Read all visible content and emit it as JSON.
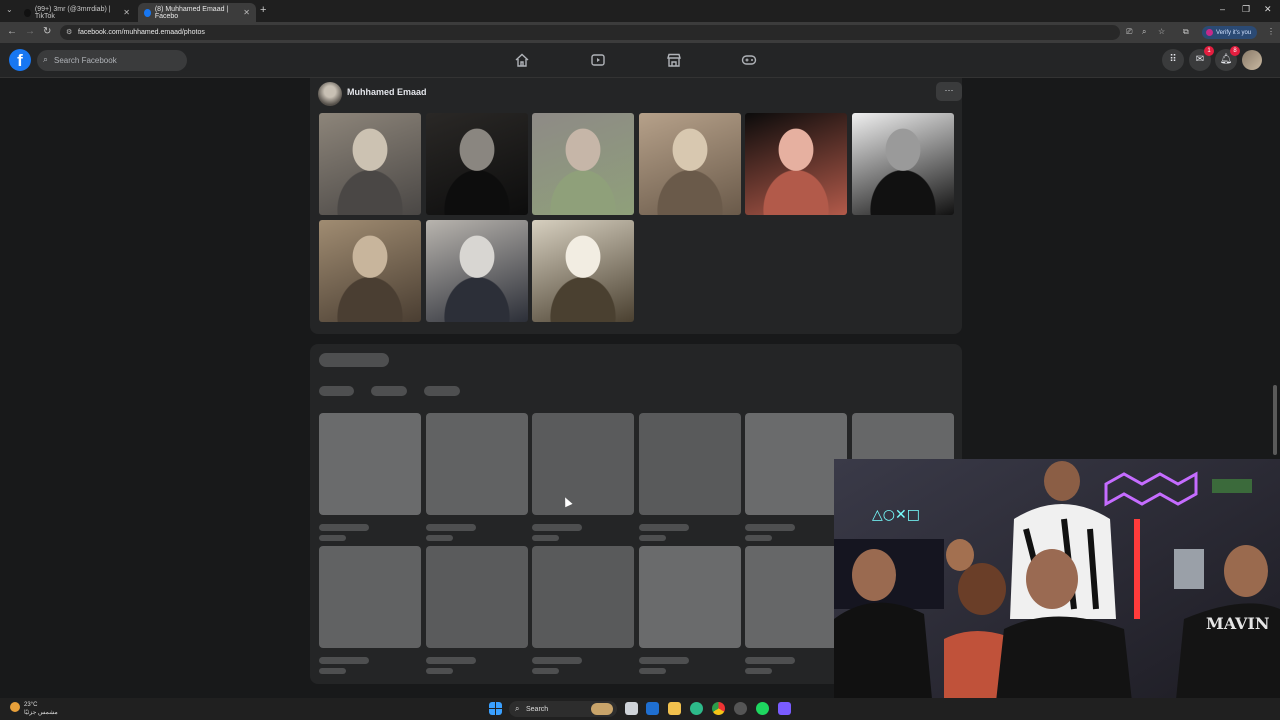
{
  "browser": {
    "tabs": [
      {
        "title": "(99+) 3mr (@3mrrdiab) | TikTok",
        "active": false,
        "favicon_color": "#111111"
      },
      {
        "title": "(8) Muhhamed Emaad | Facebo",
        "active": true,
        "favicon_color": "#1877f2"
      }
    ],
    "url": "facebook.com/muhhamed.emaad/photos",
    "verify_label": "Verify it's you"
  },
  "facebook": {
    "logo": "f",
    "search_placeholder": "Search Facebook",
    "nav_icons": [
      "home-icon",
      "video-icon",
      "marketplace-icon",
      "gaming-icon"
    ],
    "messenger_badge": "1",
    "notifications_badge": "8"
  },
  "profile": {
    "name": "Muhhamed Emaad",
    "more_label": "···",
    "photos": [
      {
        "name": "photo-man-hoodie",
        "colors": [
          "#8d857a",
          "#4a4745",
          "#ccc2b2"
        ]
      },
      {
        "name": "photo-elderly-woman",
        "colors": [
          "#2a2826",
          "#0d0d0d",
          "#8a8680"
        ]
      },
      {
        "name": "photo-grave-flowers",
        "colors": [
          "#8e8a86",
          "#8fa07a",
          "#c6b6a8"
        ]
      },
      {
        "name": "photo-man-plaid-shirt",
        "colors": [
          "#b6a18a",
          "#6a5a4a",
          "#d8c8b0"
        ]
      },
      {
        "name": "photo-man-red-light",
        "colors": [
          "#0b0b0b",
          "#b25a4a",
          "#e6b0a0"
        ]
      },
      {
        "name": "photo-arabic-calligraphy",
        "colors": [
          "#f0f0f0",
          "#111111",
          "#9a9a9a"
        ]
      },
      {
        "name": "photo-man-balcony",
        "colors": [
          "#a08c72",
          "#4a3e32",
          "#c8b59c"
        ]
      },
      {
        "name": "photo-man-suit",
        "colors": [
          "#b8b4ae",
          "#2c2f38",
          "#d8d6d2"
        ]
      },
      {
        "name": "photo-poster-fashion",
        "colors": [
          "#d6cfbf",
          "#4a4030",
          "#f2ede2"
        ]
      }
    ]
  },
  "taskbar": {
    "temperature": "23°C",
    "weather_text": "مشمس جزئيًا",
    "search_label": "Search"
  }
}
